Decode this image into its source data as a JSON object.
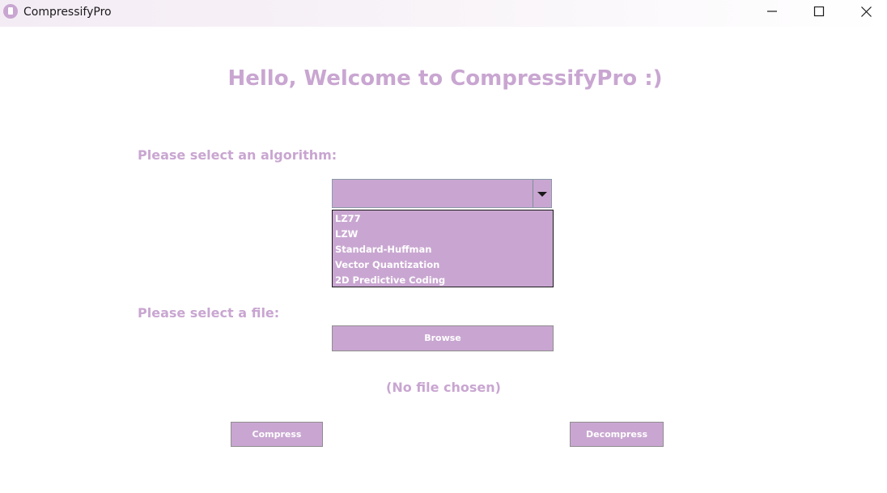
{
  "window": {
    "title": "CompressifyPro"
  },
  "main": {
    "heading": "Hello, Welcome to CompressifyPro :)",
    "algorithm_label": "Please select an algorithm:",
    "file_label": "Please select a file:",
    "algorithm_select": {
      "selected_value": "",
      "options": [
        "LZ77",
        "LZW",
        "Standard-Huffman",
        "Vector Quantization",
        "2D Predictive Coding"
      ]
    },
    "browse_label": "Browse",
    "file_status": "(No file chosen)",
    "compress_label": "Compress",
    "decompress_label": "Decompress"
  },
  "colors": {
    "accent": "#c9a6d1",
    "button_text": "#ffffff",
    "titlebar_text": "#1a1a1a"
  },
  "icons": {
    "app": "app-logo-icon",
    "minimize": "minimize-icon",
    "maximize": "maximize-icon",
    "close": "close-icon",
    "dropdown": "chevron-down-icon"
  }
}
